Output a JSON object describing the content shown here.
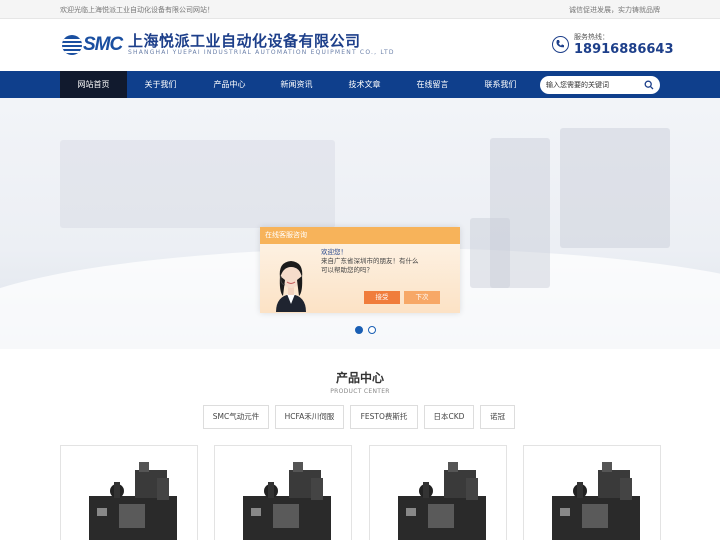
{
  "topbar": {
    "welcome": "欢迎光临上海悦派工业自动化设备有限公司网站！",
    "slogan": "诚信促进发展，实力铸就品牌"
  },
  "header": {
    "logo_text": "SMC",
    "company_name": "上海悦派工业自动化设备有限公司",
    "company_name_en": "SHANGHAI YUEPAI INDUSTRIAL AUTOMATION EQUIPMENT CO., LTD",
    "hotline_label": "服务热线：",
    "hotline_number": "18916886643"
  },
  "nav": {
    "items": [
      {
        "label": "网站首页",
        "active": true
      },
      {
        "label": "关于我们"
      },
      {
        "label": "产品中心"
      },
      {
        "label": "新闻资讯"
      },
      {
        "label": "技术文章"
      },
      {
        "label": "在线留言"
      },
      {
        "label": "联系我们"
      }
    ],
    "search_placeholder": "输入您需要的关键词"
  },
  "chat": {
    "title": "在线客服咨询",
    "line1": "欢迎您！",
    "line2": "来自广东省深圳市的朋友！有什么",
    "line3": "可以帮助您的吗？",
    "accept": "接受",
    "later": "下次"
  },
  "products": {
    "title": "产品中心",
    "subtitle": "PRODUCT CENTER",
    "tabs": [
      "SMC气动元件",
      "HCFA禾川伺服",
      "FESTO费斯托",
      "日本CKD",
      "诺冠"
    ]
  },
  "colors": {
    "brand": "#0f3f8c",
    "nav_active": "#111a2e",
    "chat_header": "#f7b35a",
    "accept_button": "#f07d3c"
  }
}
